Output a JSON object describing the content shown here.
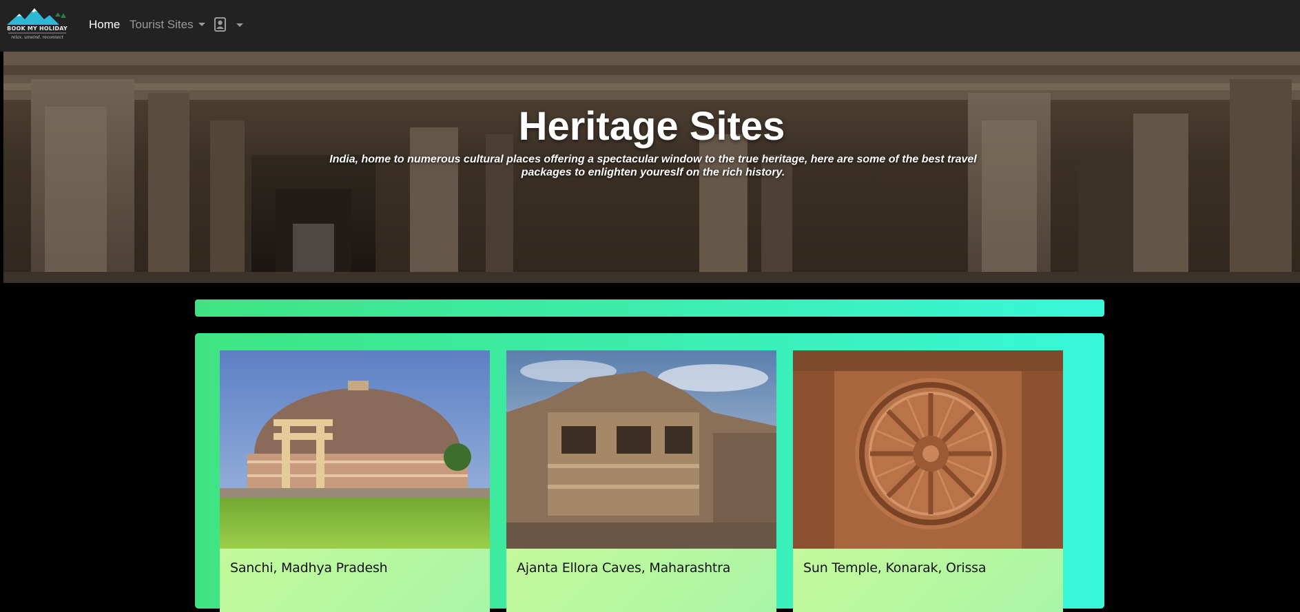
{
  "navbar": {
    "logo": {
      "brand_text": "BOOK MY HOLIDAY",
      "tagline": "relax. unwind. reconnect"
    },
    "home_label": "Home",
    "tourist_sites_label": "Tourist Sites",
    "icons": {
      "user": "user-icon",
      "dropdown": "chevron-down-icon"
    }
  },
  "hero": {
    "title": "Heritage Sites",
    "subtitle": "India, home to numerous cultural places offering a spectacular window to the true heritage, here are some of the best travel packages to enlighten youreslf on the rich history."
  },
  "cards": [
    {
      "title": "Sanchi, Madhya Pradesh"
    },
    {
      "title": "Ajanta Ellora Caves, Maharashtra"
    },
    {
      "title": "Sun Temple, Konarak, Orissa"
    }
  ],
  "colors": {
    "navbar_bg": "#222222",
    "accent_gradient_start": "#3fe382",
    "accent_gradient_end": "#38f7d9",
    "card_bg_start": "#d4fa95",
    "card_bg_end": "#a9f6a6"
  }
}
